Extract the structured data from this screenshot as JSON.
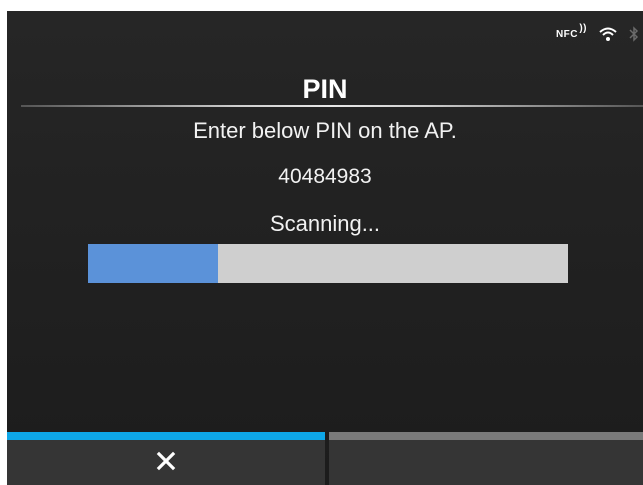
{
  "status": {
    "nfc_label": "NFC",
    "nfc_wave": "))",
    "icons": [
      "nfc-icon",
      "wifi-icon",
      "bluetooth-icon"
    ]
  },
  "header": {
    "title": "PIN"
  },
  "body": {
    "instruction": "Enter below PIN on the AP.",
    "pin": "40484983",
    "status_text": "Scanning...",
    "progress_fraction": 0.27
  },
  "softkeys": {
    "left_icon": "close-icon",
    "right_label": ""
  },
  "colors": {
    "background": "#1e1e1e",
    "progress_fill": "#5b92d9",
    "progress_track": "#cfcfcf",
    "active_key_bar": "#0ea7e8",
    "inactive_key_bar": "#7a7a7a"
  }
}
